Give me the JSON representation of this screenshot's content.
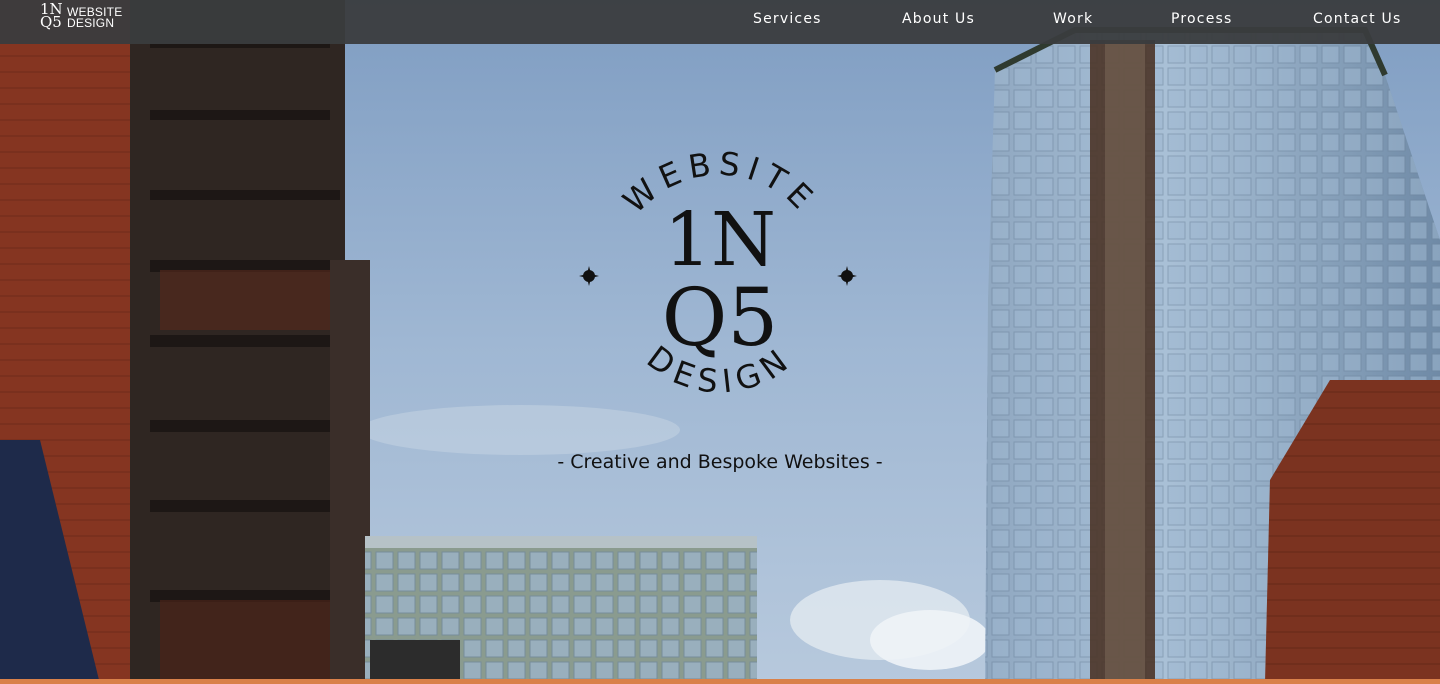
{
  "nav": {
    "logo_mono_line1": "1N",
    "logo_mono_line2": "Q5",
    "logo_word1": "WEBSITE",
    "logo_word2": "DESIGN",
    "items": [
      {
        "label": "Services"
      },
      {
        "label": "About Us"
      },
      {
        "label": "Work"
      },
      {
        "label": "Process"
      },
      {
        "label": "Contact Us"
      }
    ]
  },
  "hero": {
    "emblem_top_word": "WEBSITE",
    "emblem_bottom_word": "DESIGN",
    "emblem_mono_line1": "1N",
    "emblem_mono_line2": "Q5",
    "tagline": "- Creative and Bespoke Websites -"
  },
  "colors": {
    "nav_bg": "#3a3c3e",
    "accent_bar": "#d9814a",
    "emblem_ink": "#111111"
  }
}
